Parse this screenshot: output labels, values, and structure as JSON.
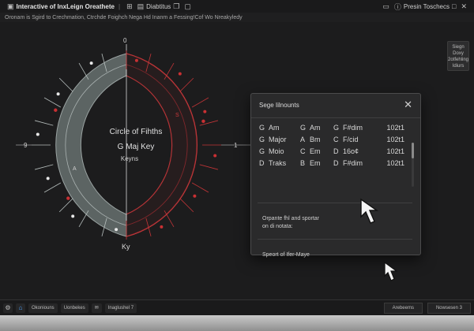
{
  "titlebar": {
    "title": "Interactive of InxLeign Oreathete",
    "tools": [
      "Diabtitus"
    ],
    "right_label": "Presin Toschecs"
  },
  "subbar": {
    "text": "Oronam is Sgird to Crechmation, Ctrchde Foighch Nega Hd Inanm a Fessing!Cof Wo Nreakyledy"
  },
  "side_panel": {
    "lines": [
      "Siegn",
      "Doxy",
      "2otfehling",
      "Idiurs"
    ]
  },
  "wheel": {
    "center_title": "Circle of Fihths",
    "center_key": "G Maj Key",
    "center_sub": "Keyns",
    "label_top": "0",
    "label_left": "9",
    "label_right": "1",
    "label_bottom": "Ky",
    "inner_left": "A",
    "inner_right": "S",
    "colors": {
      "left_fill": "#5c6463",
      "right_stroke": "#d0383b",
      "dot": "#e8e8e8",
      "red_dot": "#c93033"
    }
  },
  "dialog": {
    "title": "Sege Iilnounts",
    "rows": [
      [
        "G",
        "Am",
        "G",
        "Am",
        "G",
        "F#dim",
        "102t1"
      ],
      [
        "G",
        "Major",
        "A",
        "Bm",
        "C",
        "F/cid",
        "102t1"
      ],
      [
        "G",
        "Moio",
        "C",
        "Em",
        "D",
        "16o¢",
        "102t1"
      ],
      [
        "D",
        "Traks",
        "B",
        "Em",
        "D",
        "F#dim",
        "102t1"
      ]
    ],
    "section1": "Orpante fhl and sportar\non di notata:",
    "section2": "Speort of Ifer-Maye"
  },
  "bottom": {
    "items": [
      "Okoniouns",
      "Uonbekes",
      "Inaglushel 7"
    ],
    "right_a": "Arebeems",
    "right_b": "Nowsesen 3"
  }
}
